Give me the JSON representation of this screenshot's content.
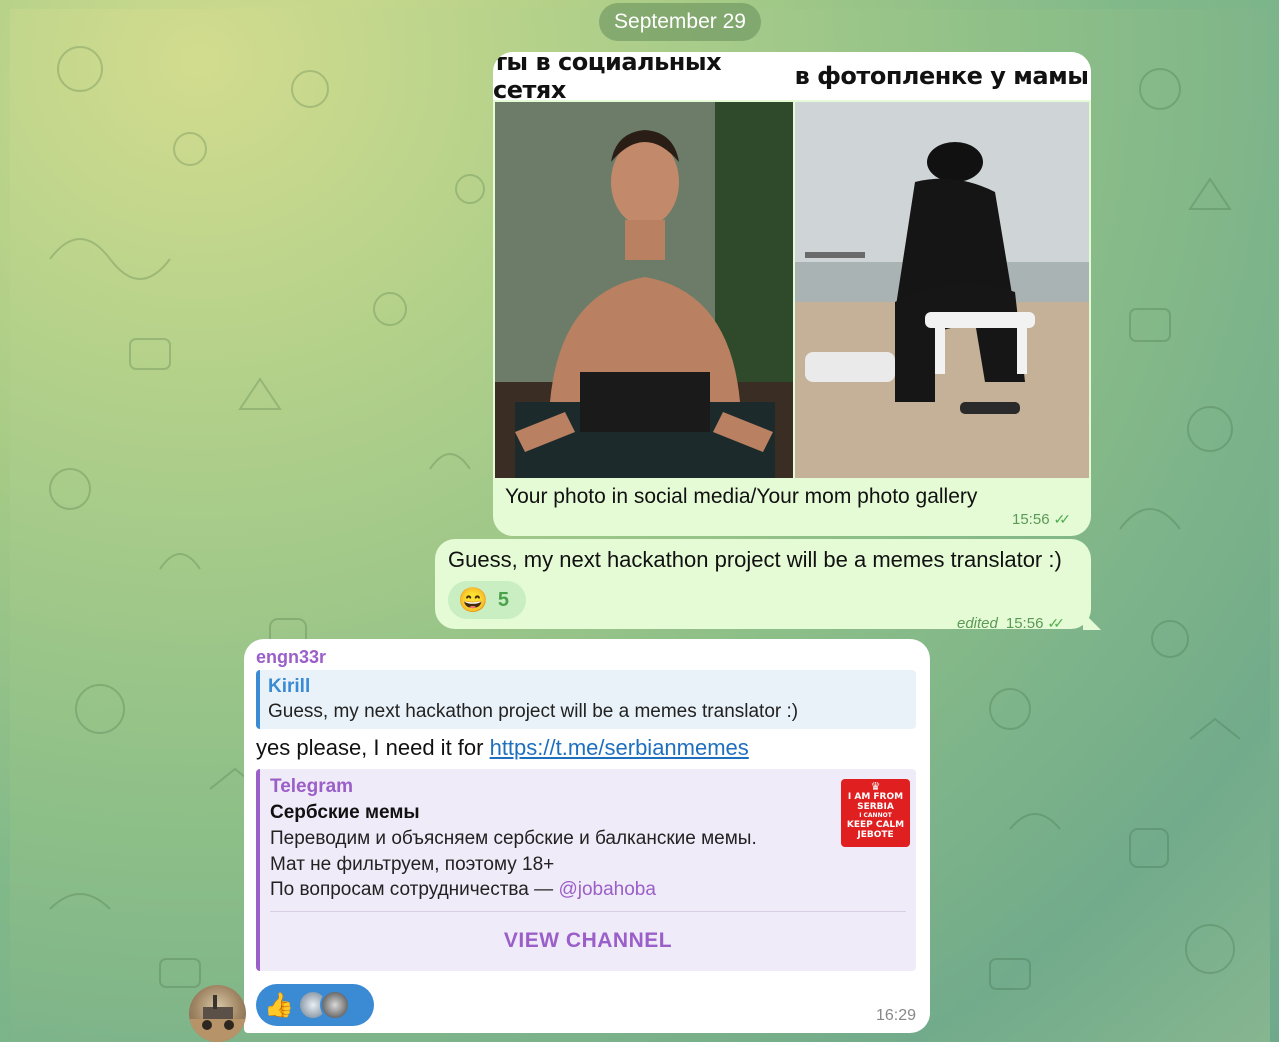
{
  "date_separator": "September 29",
  "photo_message": {
    "meme_left_caption": "ты в социальных сетях",
    "meme_right_caption": "в фотопленке у мамы",
    "caption": "Your photo in social media/Your mom photo gallery",
    "time": "15:56"
  },
  "text_message": {
    "text": "Guess, my next hackathon project will be a memes translator :)",
    "reaction_emoji": "😄",
    "reaction_count": "5",
    "edited_label": "edited",
    "time": "15:56"
  },
  "reply_message": {
    "sender": "engn33r",
    "reply_name": "Kirill",
    "reply_text": "Guess, my next hackathon project will be a memes translator :)",
    "text_prefix": "yes please, I need it for ",
    "link": "https://t.me/serbianmemes",
    "preview": {
      "site": "Telegram",
      "title": "Сербские мемы",
      "line1": "Переводим и объясняем сербские и балканские мемы.",
      "line2": "Мат не фильтруем, поэтому 18+",
      "line3_prefix": "По вопросам сотрудничества — ",
      "mention": "@jobahoba",
      "button": "VIEW CHANNEL",
      "thumb_lines": [
        "I AM FROM",
        "SERBIA",
        "I CANNOT",
        "KEEP CALM",
        "JEBOTE"
      ]
    },
    "reaction_emoji": "👍",
    "time": "16:29"
  },
  "colors": {
    "outgoing_bubble": "#e5fbd6",
    "accent_purple": "#9a5fc8",
    "accent_blue": "#3a8ad4"
  }
}
